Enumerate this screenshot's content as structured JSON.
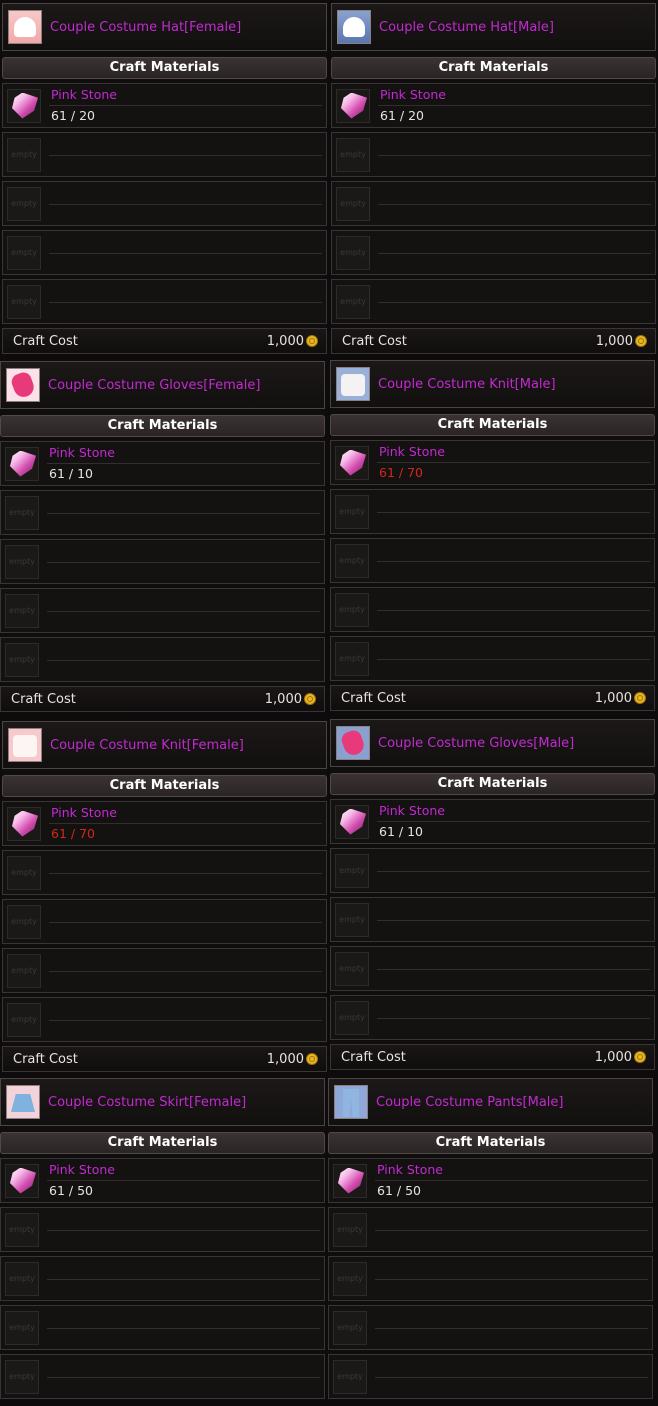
{
  "labels": {
    "craft_materials": "Craft Materials",
    "craft_cost": "Craft Cost",
    "empty": "empty"
  },
  "panels": [
    {
      "title": "Couple Costume Hat[Female]",
      "icon": "hat-female-icon",
      "material": "Pink Stone",
      "count": "61 / 20",
      "sufficient": true,
      "cost": "1,000"
    },
    {
      "title": "Couple Costume Hat[Male]",
      "icon": "hat-male-icon",
      "material": "Pink Stone",
      "count": "61 / 20",
      "sufficient": true,
      "cost": "1,000"
    },
    {
      "title": "Couple Costume Gloves[Female]",
      "icon": "gloves-female-icon",
      "material": "Pink Stone",
      "count": "61 / 10",
      "sufficient": true,
      "cost": "1,000"
    },
    {
      "title": "Couple Costume Knit[Male]",
      "icon": "knit-male-icon",
      "material": "Pink Stone",
      "count": "61 / 70",
      "sufficient": false,
      "cost": "1,000"
    },
    {
      "title": "Couple Costume Knit[Female]",
      "icon": "knit-female-icon",
      "material": "Pink Stone",
      "count": "61 / 70",
      "sufficient": false,
      "cost": "1,000"
    },
    {
      "title": "Couple Costume Gloves[Male]",
      "icon": "gloves-male-icon",
      "material": "Pink Stone",
      "count": "61 / 10",
      "sufficient": true,
      "cost": "1,000"
    },
    {
      "title": "Couple Costume Skirt[Female]",
      "icon": "skirt-female-icon",
      "material": "Pink Stone",
      "count": "61 / 50",
      "sufficient": true,
      "cost": null
    },
    {
      "title": "Couple Costume Pants[Male]",
      "icon": "pants-male-icon",
      "material": "Pink Stone",
      "count": "61 / 50",
      "sufficient": true,
      "cost": null
    }
  ],
  "colors": {
    "item_name": "#c22ad0",
    "insufficient": "#d0281c",
    "text": "#e8e2e2"
  }
}
